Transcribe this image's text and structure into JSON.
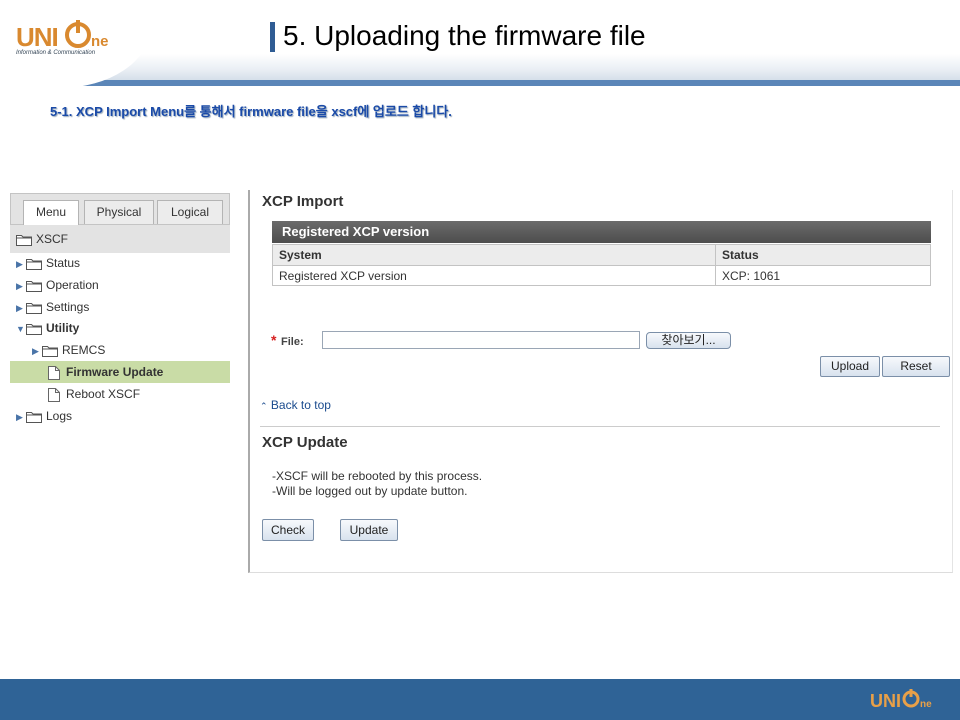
{
  "slide": {
    "logo_text_left": "UNI",
    "logo_text_right": "ne",
    "logo_tagline": "Information & Communication",
    "title": "5. Uploading the firmware file",
    "subtitle": "5-1. XCP Import Menu를 통해서 firmware file을 xscf에 업로드 합니다."
  },
  "nav": {
    "tabs": [
      {
        "label": "Menu",
        "active": true
      },
      {
        "label": "Physical",
        "active": false
      },
      {
        "label": "Logical",
        "active": false
      }
    ],
    "root_label": "XSCF",
    "items": [
      {
        "label": "Status",
        "type": "folder",
        "expanded": false
      },
      {
        "label": "Operation",
        "type": "folder",
        "expanded": false
      },
      {
        "label": "Settings",
        "type": "folder",
        "expanded": false
      },
      {
        "label": "Utility",
        "type": "folder",
        "expanded": true
      },
      {
        "label": "REMCS",
        "type": "folder",
        "expanded": false
      },
      {
        "label": "Firmware Update",
        "type": "doc",
        "selected": true
      },
      {
        "label": "Reboot XSCF",
        "type": "doc",
        "selected": false
      },
      {
        "label": "Logs",
        "type": "folder",
        "expanded": false
      }
    ]
  },
  "xcp_import": {
    "heading": "XCP Import",
    "table_caption": "Registered XCP version",
    "columns": [
      "System",
      "Status"
    ],
    "rows": [
      {
        "system": "Registered XCP version",
        "status": "XCP: 1061"
      }
    ],
    "required_mark": "*",
    "file_label": "File:",
    "file_value": "",
    "browse_label": "찾아보기...",
    "upload_label": "Upload",
    "reset_label": "Reset",
    "back_to_top": "Back to top"
  },
  "xcp_update": {
    "heading": "XCP Update",
    "notes": [
      "-XSCF will be rebooted by this process.",
      "-Will be logged out by update button."
    ],
    "check_label": "Check",
    "update_label": "Update"
  },
  "colors": {
    "brand_orange": "#d9892f",
    "header_blue": "#2f5c94",
    "footer_blue": "#2f6396",
    "subtitle_blue": "#1a4aa8",
    "selected_item": "#c9dca6",
    "link_blue": "#1a4b8e",
    "required_red": "#d62020"
  }
}
